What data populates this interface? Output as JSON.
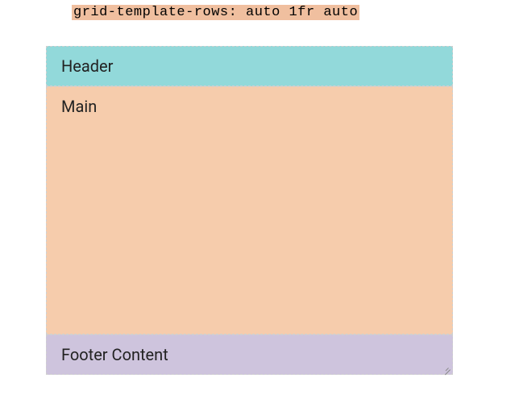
{
  "code_label": "grid-template-rows: auto 1fr auto",
  "header": {
    "label": "Header"
  },
  "main": {
    "label": "Main"
  },
  "footer": {
    "label": "Footer Content"
  }
}
